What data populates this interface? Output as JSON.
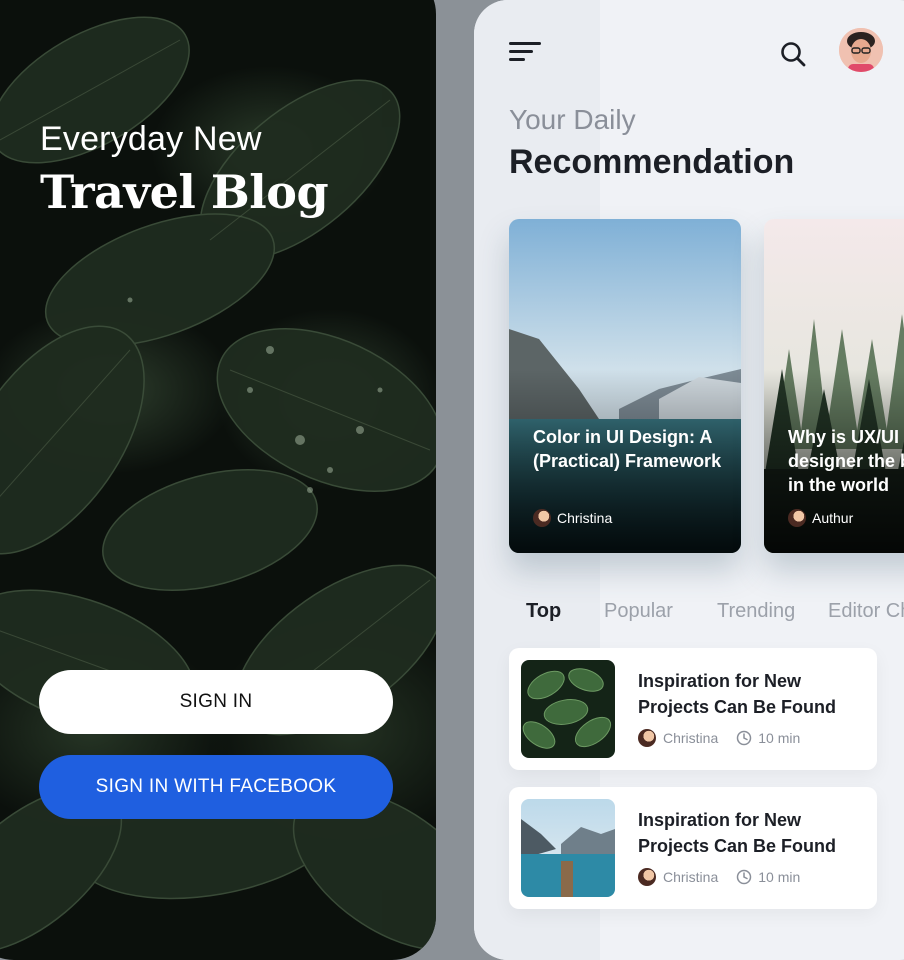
{
  "login": {
    "subtitle": "Everyday New",
    "title": "Travel Blog",
    "sign_in_label": "SIGN IN",
    "facebook_label": "SIGN IN WITH FACEBOOK"
  },
  "home": {
    "icons": {
      "menu": "menu-icon",
      "search": "search-icon",
      "avatar": "user-avatar"
    },
    "heading_light": "Your Daily",
    "heading_bold": "Recommendation",
    "cards": [
      {
        "title": "Color in UI Design: A (Practical) Framework",
        "author": "Christina"
      },
      {
        "title": "Why is UX/UI designer the best job in the world",
        "author": "Authur"
      }
    ],
    "tabs": [
      {
        "label": "Top",
        "active": true
      },
      {
        "label": "Popular",
        "active": false
      },
      {
        "label": "Trending",
        "active": false
      },
      {
        "label": "Editor Choice",
        "active": false
      }
    ],
    "list": [
      {
        "title": "Inspiration for New Projects Can Be Found",
        "author": "Christina",
        "read_time": "10 min"
      },
      {
        "title": "Inspiration for New Projects Can Be Found",
        "author": "Christina",
        "read_time": "10 min"
      }
    ]
  },
  "colors": {
    "facebook_blue": "#1f5fe0",
    "text_dark": "#1c1f26",
    "text_muted": "#8a8f99"
  }
}
